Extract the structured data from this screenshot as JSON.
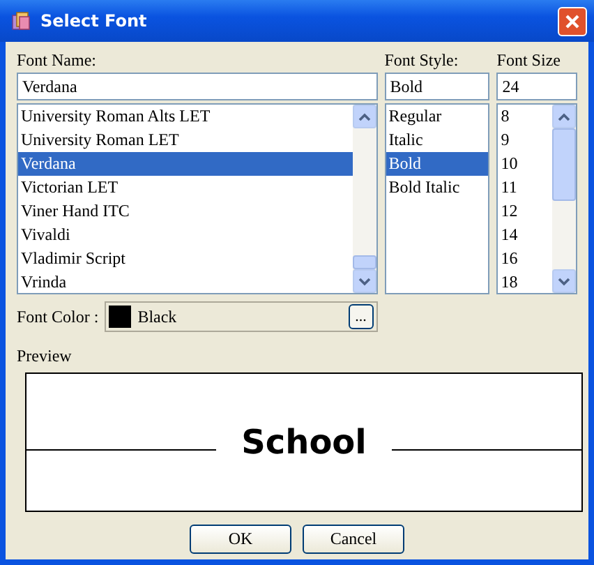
{
  "window": {
    "title": "Select Font"
  },
  "font_name": {
    "label": "Font Name:",
    "value": "Verdana",
    "items": [
      {
        "label": "University Roman Alts LET",
        "selected": false
      },
      {
        "label": "University Roman LET",
        "selected": false
      },
      {
        "label": "Verdana",
        "selected": true
      },
      {
        "label": "Victorian LET",
        "selected": false
      },
      {
        "label": "Viner Hand ITC",
        "selected": false
      },
      {
        "label": "Vivaldi",
        "selected": false
      },
      {
        "label": "Vladimir Script",
        "selected": false
      },
      {
        "label": "Vrinda",
        "selected": false
      }
    ]
  },
  "font_style": {
    "label": "Font Style:",
    "value": "Bold",
    "items": [
      {
        "label": "Regular",
        "selected": false
      },
      {
        "label": "Italic",
        "selected": false
      },
      {
        "label": "Bold",
        "selected": true
      },
      {
        "label": "Bold Italic",
        "selected": false
      }
    ]
  },
  "font_size": {
    "label": "Font Size",
    "value": "24",
    "items": [
      {
        "label": "8",
        "selected": false
      },
      {
        "label": "9",
        "selected": false
      },
      {
        "label": "10",
        "selected": false
      },
      {
        "label": "11",
        "selected": false
      },
      {
        "label": "12",
        "selected": false
      },
      {
        "label": "14",
        "selected": false
      },
      {
        "label": "16",
        "selected": false
      },
      {
        "label": "18",
        "selected": false
      }
    ]
  },
  "font_color": {
    "label": "Font Color :",
    "color": "#000000",
    "name": "Black",
    "button": "..."
  },
  "preview": {
    "label": "Preview",
    "text": "School"
  },
  "buttons": [
    "OK",
    "Cancel"
  ]
}
